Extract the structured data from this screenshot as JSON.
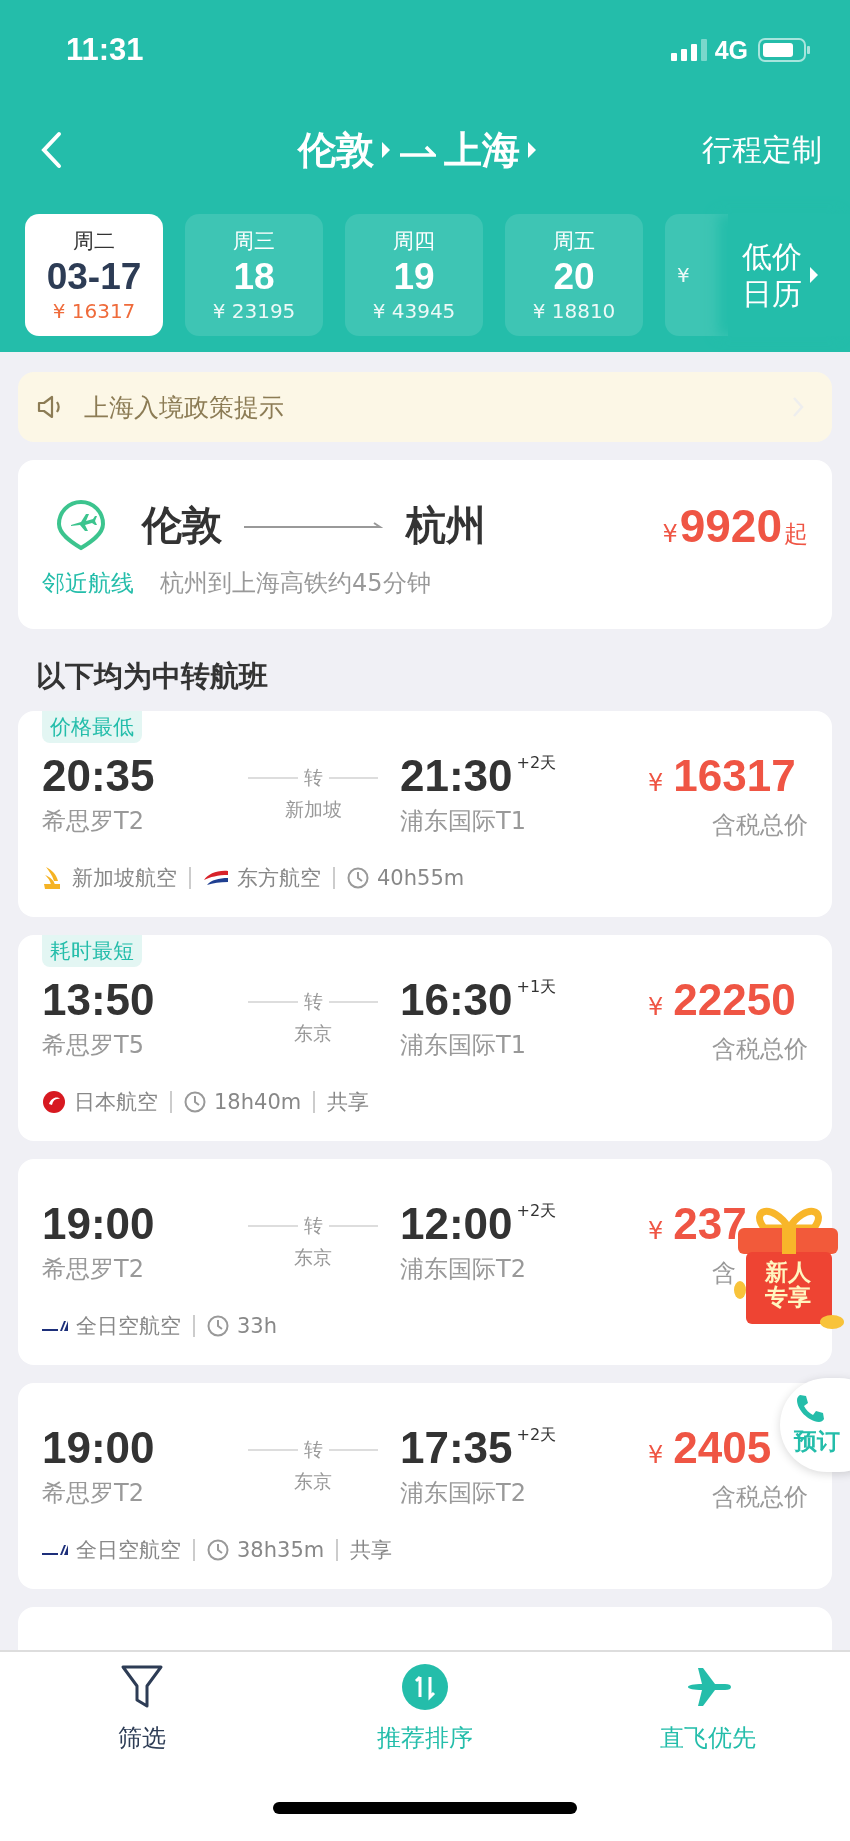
{
  "status_bar": {
    "time": "11:31",
    "network": "4G"
  },
  "nav": {
    "from": "伦敦",
    "to": "上海",
    "action": "行程定制"
  },
  "dates": [
    {
      "weekday": "周二",
      "day": "03-17",
      "price": "¥ 16317",
      "selected": true
    },
    {
      "weekday": "周三",
      "day": "18",
      "price": "¥ 23195",
      "selected": false
    },
    {
      "weekday": "周四",
      "day": "19",
      "price": "¥ 43945",
      "selected": false
    },
    {
      "weekday": "周五",
      "day": "20",
      "price": "¥ 18810",
      "selected": false
    },
    {
      "price": "¥",
      "selected": false
    }
  ],
  "calendar_button": {
    "line1": "低价",
    "line2": "日历"
  },
  "notice": {
    "text": "上海入境政策提示"
  },
  "nearby": {
    "from": "伦敦",
    "to": "杭州",
    "currency": "¥",
    "price": "9920",
    "suffix": "起",
    "tag": "邻近航线",
    "note": "杭州到上海高铁约45分钟"
  },
  "section_title": "以下均为中转航班",
  "flights": [
    {
      "badge": "价格最低",
      "dep_time": "20:35",
      "dep_airport": "希思罗T2",
      "transfer": "转",
      "via": "新加坡",
      "arr_time": "21:30",
      "day_offset": "+2天",
      "arr_airport": "浦东国际T1",
      "currency": "¥",
      "price": "16317",
      "price_note": "含税总价",
      "meta": [
        {
          "kind": "bird",
          "text": "新加坡航空"
        },
        {
          "kind": "swoosh",
          "text": "东方航空"
        },
        {
          "kind": "duration",
          "text": "40h55m"
        }
      ]
    },
    {
      "badge": "耗时最短",
      "dep_time": "13:50",
      "dep_airport": "希思罗T5",
      "transfer": "转",
      "via": "东京",
      "arr_time": "16:30",
      "day_offset": "+1天",
      "arr_airport": "浦东国际T1",
      "currency": "¥",
      "price": "22250",
      "price_note": "含税总价",
      "meta": [
        {
          "kind": "circle",
          "text": "日本航空"
        },
        {
          "kind": "duration",
          "text": "18h40m"
        },
        {
          "kind": "tag",
          "text": "共享"
        }
      ]
    },
    {
      "dep_time": "19:00",
      "dep_airport": "希思罗T2",
      "transfer": "转",
      "via": "东京",
      "arr_time": "12:00",
      "day_offset": "+2天",
      "arr_airport": "浦东国际T2",
      "currency": "¥",
      "price": "237",
      "price_note": "含",
      "meta": [
        {
          "kind": "stripes",
          "text": "全日空航空"
        },
        {
          "kind": "duration",
          "text": "33h"
        }
      ]
    },
    {
      "dep_time": "19:00",
      "dep_airport": "希思罗T2",
      "transfer": "转",
      "via": "东京",
      "arr_time": "17:35",
      "day_offset": "+2天",
      "arr_airport": "浦东国际T2",
      "currency": "¥",
      "price": "2405",
      "price_note": "含税总价",
      "meta": [
        {
          "kind": "stripes",
          "text": "全日空航空"
        },
        {
          "kind": "duration",
          "text": "38h35m"
        },
        {
          "kind": "tag",
          "text": "共享"
        }
      ]
    }
  ],
  "promo_badge": {
    "line1": "新人",
    "line2": "专享"
  },
  "book_button": {
    "label": "预订"
  },
  "bottom_tabs": [
    {
      "kind": "filter",
      "label": "筛选",
      "highlighted": false
    },
    {
      "kind": "sort",
      "label": "推荐排序",
      "highlighted": true
    },
    {
      "kind": "direct",
      "label": "直飞优先",
      "highlighted": true
    }
  ]
}
